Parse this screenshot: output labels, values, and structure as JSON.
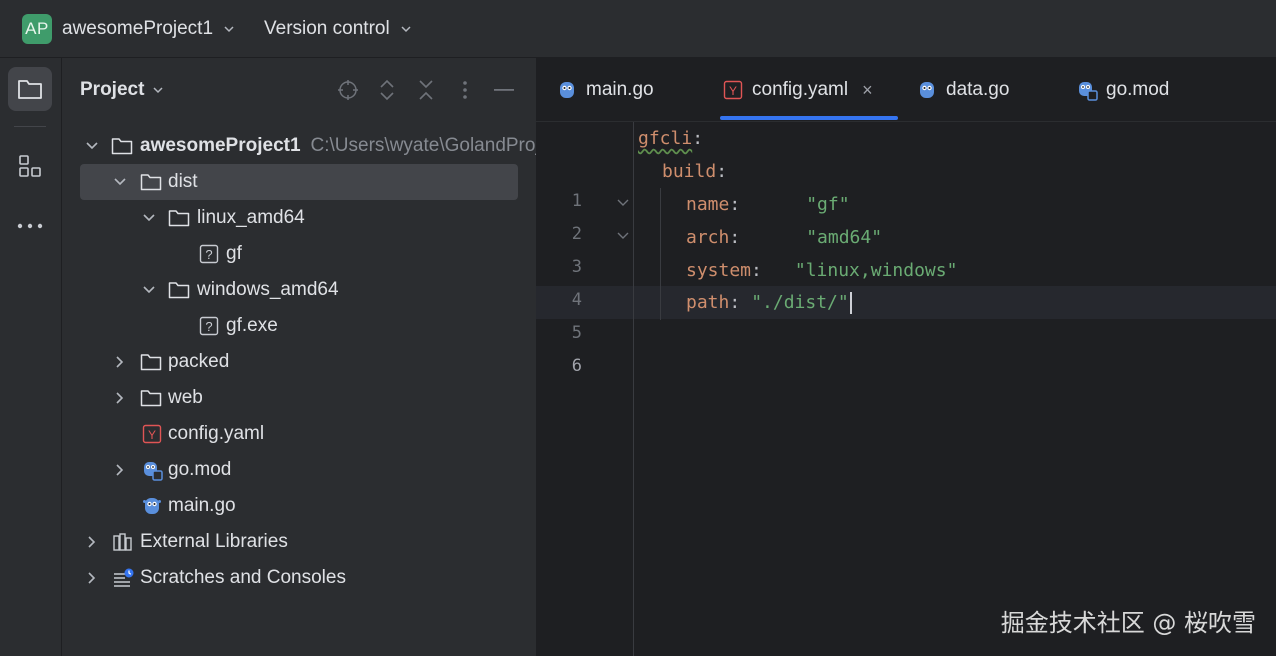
{
  "topbar": {
    "badge": "AP",
    "project_name": "awesomeProject1",
    "vcs_label": "Version control"
  },
  "toolstrip": {
    "items": [
      {
        "icon": "folder-icon",
        "active": true
      },
      {
        "icon": "structure-icon",
        "active": false
      },
      {
        "icon": "more-icon",
        "active": false
      }
    ]
  },
  "project_panel": {
    "title": "Project",
    "header_icons": [
      "locate-icon",
      "expand-all-icon",
      "collapse-all-icon",
      "options-icon",
      "hide-icon"
    ],
    "tree": [
      {
        "label": "awesomeProject1",
        "hint": "C:\\Users\\wyate\\GolandProj",
        "icon": "folder-icon",
        "expanded": true,
        "bold": true
      },
      {
        "label": "dist",
        "icon": "folder-icon",
        "expanded": true,
        "selected": true
      },
      {
        "label": "linux_amd64",
        "icon": "folder-icon",
        "expanded": true
      },
      {
        "label": "gf",
        "icon": "unknown-file-icon"
      },
      {
        "label": "windows_amd64",
        "icon": "folder-icon",
        "expanded": true
      },
      {
        "label": "gf.exe",
        "icon": "unknown-file-icon"
      },
      {
        "label": "packed",
        "icon": "folder-icon",
        "expanded": false
      },
      {
        "label": "web",
        "icon": "folder-icon",
        "expanded": false
      },
      {
        "label": "config.yaml",
        "icon": "yaml-file-icon"
      },
      {
        "label": "go.mod",
        "icon": "go-mod-icon",
        "expanded": false
      },
      {
        "label": "main.go",
        "icon": "go-file-icon"
      },
      {
        "label": "External Libraries",
        "icon": "library-icon",
        "expanded": false
      },
      {
        "label": "Scratches and Consoles",
        "icon": "scratches-icon",
        "expanded": false
      }
    ]
  },
  "editor": {
    "tabs": [
      {
        "label": "main.go",
        "icon": "go-file-icon",
        "active": false
      },
      {
        "label": "config.yaml",
        "icon": "yaml-file-icon",
        "active": true,
        "close": "×"
      },
      {
        "label": "data.go",
        "icon": "go-file-icon",
        "active": false
      },
      {
        "label": "go.mod",
        "icon": "go-mod-icon",
        "active": false
      }
    ],
    "line_numbers": [
      "1",
      "2",
      "3",
      "4",
      "5",
      "6"
    ],
    "code": {
      "l1_key": "gfcli",
      "colon": ":",
      "l2_key": "build",
      "l3_key": "name",
      "l3_val": "\"gf\"",
      "l4_key": "arch",
      "l4_val": "\"amd64\"",
      "l5_key": "system",
      "l5_val": "\"linux,windows\"",
      "l6_key": "path",
      "l6_val": "\"./dist/\""
    },
    "current_line": 6
  },
  "watermark": "掘金技术社区 @ 桜吹雪",
  "colors": {
    "accent": "#3574f0",
    "yaml_key": "#cf8e6d",
    "yaml_string": "#6aab73",
    "badge": "#3f9c6b"
  }
}
